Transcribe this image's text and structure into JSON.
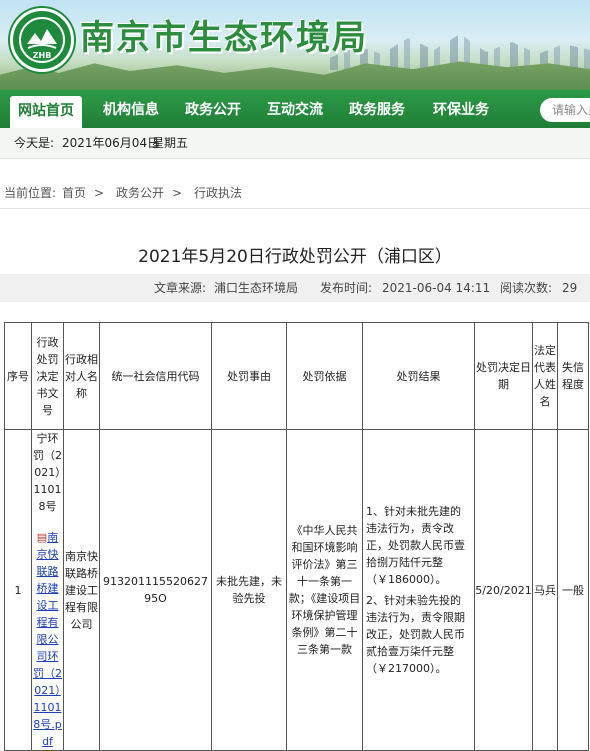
{
  "site": {
    "title": "南京市生态环境局",
    "logo_text": "ZHB",
    "colors": {
      "green": "#1f7e36",
      "nav": "#2e9a48"
    }
  },
  "nav": {
    "items": [
      "网站首页",
      "机构信息",
      "政务公开",
      "互动交流",
      "政务服务",
      "环保业务"
    ],
    "active_index": 0
  },
  "search": {
    "placeholder": "请输入关",
    "icon": "search-icon"
  },
  "datebar": {
    "label": "今天是:",
    "date": "2021年06月04日",
    "weekday": "星期五"
  },
  "breadcrumb": {
    "label": "当前位置:",
    "items": [
      "首页",
      "政务公开",
      "行政执法"
    ],
    "separator": ">"
  },
  "article": {
    "title": "2021年5月20日行政处罚公开（浦口区）",
    "source_label": "文章来源:",
    "source": "浦口生态环境局",
    "time_label": "发布时间:",
    "time": "2021-06-04 14:11",
    "reads_label": "阅读次数:",
    "reads": "29"
  },
  "table": {
    "headers": [
      "序号",
      "行政处罚决定书文号",
      "行政相对人名称",
      "统一社会信用代码",
      "处罚事由",
      "处罚依据",
      "处罚结果",
      "处罚决定日期",
      "法定代表人姓名",
      "失信程度"
    ],
    "rows": [
      {
        "index": "1",
        "doc_no": "宁环罚（2021）11018号",
        "attachment": "南京快联路桥建设工程有限公司环罚（2021）11018号.pdf",
        "party": "南京快联路桥建设工程有限公司",
        "credit_code": "91320111552062795O",
        "reason": "未批先建，未验先投",
        "basis": "《中华人民共和国环境影响评价法》第三十一条第一款；《建设项目环境保护管理条例》第二十三条第一款",
        "result_1": "1、针对未批先建的违法行为，责令改正，处罚款人民币壹拾捌万陆仟元整（￥186000）。",
        "result_2": "2、针对未验先投的违法行为，责令限期改正，处罚款人民币贰拾壹万柒仟元整（￥217000）。",
        "date": "5/20/2021",
        "legal_rep": "马兵",
        "credit_level": "一般"
      }
    ]
  }
}
